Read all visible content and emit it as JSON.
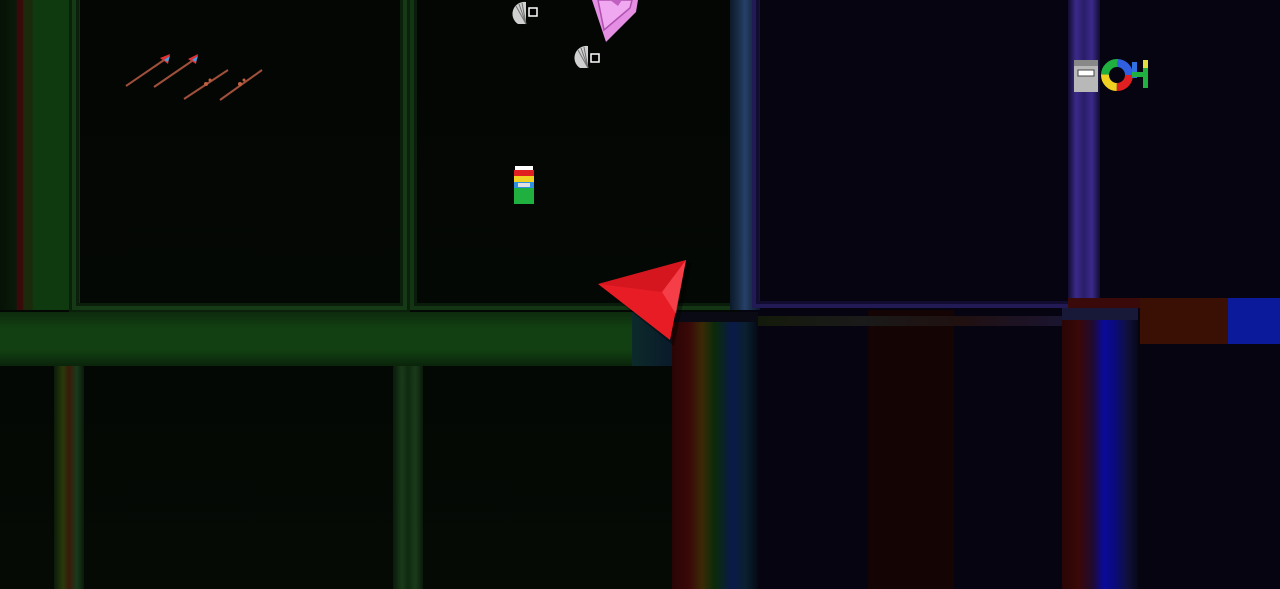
{
  "scene": {
    "cursor_color": "#e81c24",
    "colors": {
      "green_dark": "#0f3a0f",
      "green_mid": "#1e5a1e",
      "blue_frame": "#26406a",
      "purple_frame": "#3b2a8a",
      "orange_red": "#5a1a08",
      "blue_block": "#0a1a9a"
    },
    "items": [
      {
        "name": "arrow-pickup-icon",
        "count": 4
      },
      {
        "name": "cone-shield-icon",
        "count": 2
      },
      {
        "name": "pink-crystal-icon",
        "count": 1
      },
      {
        "name": "battery-pack-icon",
        "count": 1
      },
      {
        "name": "power-cell-icon",
        "count": 1
      },
      {
        "name": "color-wheel-icon",
        "count": 1
      },
      {
        "name": "letter-h-icon",
        "count": 1
      }
    ]
  }
}
